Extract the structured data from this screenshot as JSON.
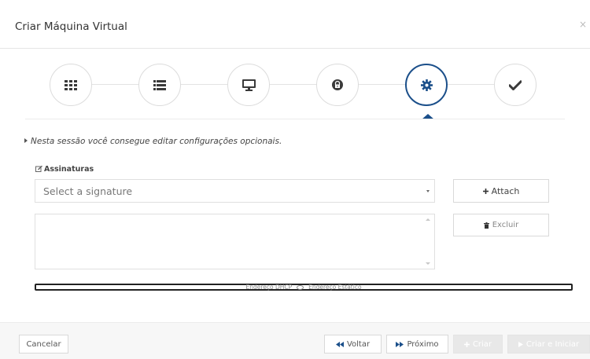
{
  "modal": {
    "title": "Criar Máquina Virtual",
    "close_symbol": "×"
  },
  "wizard": {
    "steps": [
      {
        "icon": "grid-icon",
        "active": false
      },
      {
        "icon": "list-icon",
        "active": false
      },
      {
        "icon": "monitor-icon",
        "active": false
      },
      {
        "icon": "lock-icon",
        "active": false
      },
      {
        "icon": "gear-icon",
        "active": true
      },
      {
        "icon": "checkmark-icon",
        "active": false
      }
    ],
    "active_color": "#1b4f8a"
  },
  "info_text": "Nesta sessão você consegue editar configurações opcionais.",
  "signatures": {
    "section_label": "Assinaturas",
    "select_placeholder": "Select a signature",
    "attach_label": "Attach",
    "excluir_label": "Excluir"
  },
  "ip_options": {
    "dhcp_label": "Endereço DHCP",
    "static_label": "Endereço Estático"
  },
  "footer": {
    "cancel_label": "Cancelar",
    "back_label": "Voltar",
    "next_label": "Próximo",
    "create_label": "Criar",
    "create_start_label": "Criar e Iniciar"
  }
}
